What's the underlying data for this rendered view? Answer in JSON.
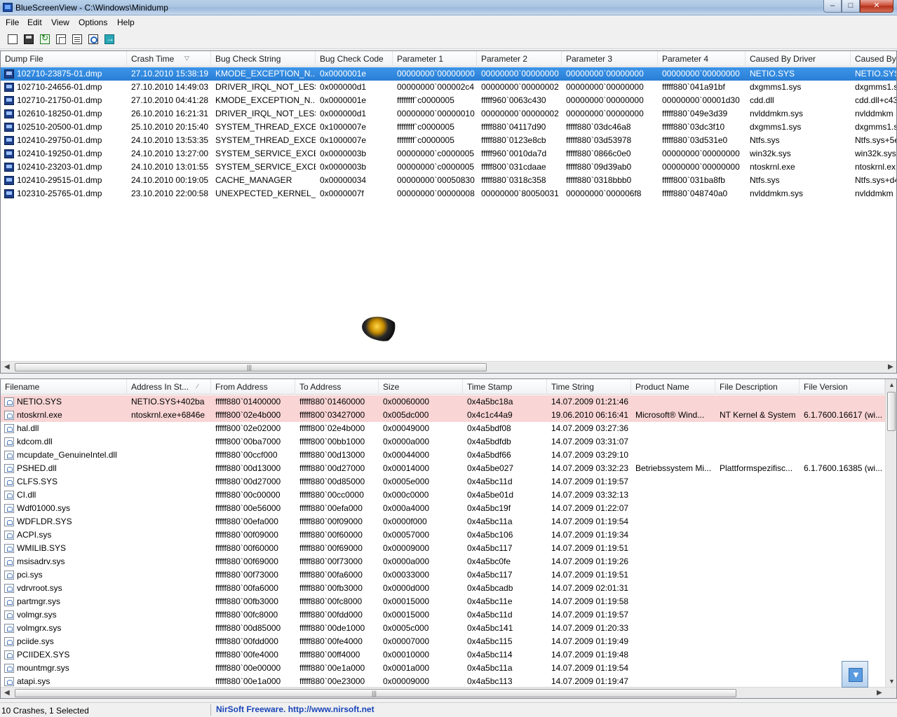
{
  "window": {
    "title": "BlueScreenView  -  C:\\Windows\\Minidump",
    "min": "–",
    "max": "□",
    "close": "✕"
  },
  "menu": [
    "File",
    "Edit",
    "View",
    "Options",
    "Help"
  ],
  "toolbar": [
    "select-columns-icon",
    "save-icon",
    "refresh-icon",
    "copy-icon",
    "properties-icon",
    "find-icon",
    "exit-icon"
  ],
  "upper": {
    "columns": [
      "Dump File",
      "Crash Time",
      "Bug Check String",
      "Bug Check Code",
      "Parameter 1",
      "Parameter 2",
      "Parameter 3",
      "Parameter 4",
      "Caused By Driver",
      "Caused By ..."
    ],
    "rows": [
      [
        "102710-23875-01.dmp",
        "27.10.2010 15:38:19",
        "KMODE_EXCEPTION_N...",
        "0x0000001e",
        "00000000`00000000",
        "00000000`00000000",
        "00000000`00000000",
        "00000000`00000000",
        "NETIO.SYS",
        "NETIO.SYS+"
      ],
      [
        "102710-24656-01.dmp",
        "27.10.2010 14:49:03",
        "DRIVER_IRQL_NOT_LESS...",
        "0x000000d1",
        "00000000`000002c4",
        "00000000`00000002",
        "00000000`00000000",
        "fffff880`041a91bf",
        "dxgmms1.sys",
        "dxgmms1.s"
      ],
      [
        "102710-21750-01.dmp",
        "27.10.2010 04:41:28",
        "KMODE_EXCEPTION_N...",
        "0x0000001e",
        "ffffffff`c0000005",
        "fffff960`0063c430",
        "00000000`00000000",
        "00000000`00001d30",
        "cdd.dll",
        "cdd.dll+c43"
      ],
      [
        "102610-18250-01.dmp",
        "26.10.2010 16:21:31",
        "DRIVER_IRQL_NOT_LESS...",
        "0x000000d1",
        "00000000`00000010",
        "00000000`00000002",
        "00000000`00000000",
        "fffff880`049e3d39",
        "nvlddmkm.sys",
        "nvlddmkm"
      ],
      [
        "102510-20500-01.dmp",
        "25.10.2010 20:15:40",
        "SYSTEM_THREAD_EXCE...",
        "0x1000007e",
        "ffffffff`c0000005",
        "fffff880`04117d90",
        "fffff880`03dc46a8",
        "fffff880`03dc3f10",
        "dxgmms1.sys",
        "dxgmms1.s"
      ],
      [
        "102410-29750-01.dmp",
        "24.10.2010 13:53:35",
        "SYSTEM_THREAD_EXCE...",
        "0x1000007e",
        "ffffffff`c0000005",
        "fffff880`0123e8cb",
        "fffff880`03d53978",
        "fffff880`03d531e0",
        "Ntfs.sys",
        "Ntfs.sys+5e"
      ],
      [
        "102410-19250-01.dmp",
        "24.10.2010 13:27:00",
        "SYSTEM_SERVICE_EXCE...",
        "0x0000003b",
        "00000000`c0000005",
        "fffff960`0010da7d",
        "fffff880`0866c0e0",
        "00000000`00000000",
        "win32k.sys",
        "win32k.sys+"
      ],
      [
        "102410-23203-01.dmp",
        "24.10.2010 13:01:55",
        "SYSTEM_SERVICE_EXCE...",
        "0x0000003b",
        "00000000`c0000005",
        "fffff800`031cdaae",
        "fffff880`09d39ab0",
        "00000000`00000000",
        "ntoskrnl.exe",
        "ntoskrnl.ex"
      ],
      [
        "102410-29515-01.dmp",
        "24.10.2010 00:19:05",
        "CACHE_MANAGER",
        "0x00000034",
        "00000000`00050830",
        "fffff880`0318c358",
        "fffff880`0318bbb0",
        "fffff800`031ba8fb",
        "Ntfs.sys",
        "Ntfs.sys+d4"
      ],
      [
        "102310-25765-01.dmp",
        "23.10.2010 22:00:58",
        "UNEXPECTED_KERNEL_...",
        "0x0000007f",
        "00000000`00000008",
        "00000000`80050031",
        "00000000`000006f8",
        "fffff880`048740a0",
        "nvlddmkm.sys",
        "nvlddmkm"
      ]
    ]
  },
  "lower": {
    "columns": [
      "Filename",
      "Address In St...",
      "From Address",
      "To Address",
      "Size",
      "Time Stamp",
      "Time String",
      "Product Name",
      "File Description",
      "File Version"
    ],
    "rows": [
      [
        "NETIO.SYS",
        "NETIO.SYS+402ba",
        "fffff880`01400000",
        "fffff880`01460000",
        "0x00060000",
        "0x4a5bc18a",
        "14.07.2009 01:21:46",
        "",
        "",
        ""
      ],
      [
        "ntoskrnl.exe",
        "ntoskrnl.exe+6846e",
        "fffff800`02e4b000",
        "fffff800`03427000",
        "0x005dc000",
        "0x4c1c44a9",
        "19.06.2010 06:16:41",
        "Microsoft® Wind...",
        "NT Kernel & System",
        "6.1.7600.16617 (wi..."
      ],
      [
        "hal.dll",
        "",
        "fffff800`02e02000",
        "fffff800`02e4b000",
        "0x00049000",
        "0x4a5bdf08",
        "14.07.2009 03:27:36",
        "",
        "",
        ""
      ],
      [
        "kdcom.dll",
        "",
        "fffff800`00ba7000",
        "fffff800`00bb1000",
        "0x0000a000",
        "0x4a5bdfdb",
        "14.07.2009 03:31:07",
        "",
        "",
        ""
      ],
      [
        "mcupdate_GenuineIntel.dll",
        "",
        "fffff880`00ccf000",
        "fffff880`00d13000",
        "0x00044000",
        "0x4a5bdf66",
        "14.07.2009 03:29:10",
        "",
        "",
        ""
      ],
      [
        "PSHED.dll",
        "",
        "fffff880`00d13000",
        "fffff880`00d27000",
        "0x00014000",
        "0x4a5be027",
        "14.07.2009 03:32:23",
        "Betriebssystem Mi...",
        "Plattformspezifisc...",
        "6.1.7600.16385 (wi..."
      ],
      [
        "CLFS.SYS",
        "",
        "fffff880`00d27000",
        "fffff880`00d85000",
        "0x0005e000",
        "0x4a5bc11d",
        "14.07.2009 01:19:57",
        "",
        "",
        ""
      ],
      [
        "CI.dll",
        "",
        "fffff880`00c00000",
        "fffff880`00cc0000",
        "0x000c0000",
        "0x4a5be01d",
        "14.07.2009 03:32:13",
        "",
        "",
        ""
      ],
      [
        "Wdf01000.sys",
        "",
        "fffff880`00e56000",
        "fffff880`00efa000",
        "0x000a4000",
        "0x4a5bc19f",
        "14.07.2009 01:22:07",
        "",
        "",
        ""
      ],
      [
        "WDFLDR.SYS",
        "",
        "fffff880`00efa000",
        "fffff880`00f09000",
        "0x0000f000",
        "0x4a5bc11a",
        "14.07.2009 01:19:54",
        "",
        "",
        ""
      ],
      [
        "ACPI.sys",
        "",
        "fffff880`00f09000",
        "fffff880`00f60000",
        "0x00057000",
        "0x4a5bc106",
        "14.07.2009 01:19:34",
        "",
        "",
        ""
      ],
      [
        "WMILIB.SYS",
        "",
        "fffff880`00f60000",
        "fffff880`00f69000",
        "0x00009000",
        "0x4a5bc117",
        "14.07.2009 01:19:51",
        "",
        "",
        ""
      ],
      [
        "msisadrv.sys",
        "",
        "fffff880`00f69000",
        "fffff880`00f73000",
        "0x0000a000",
        "0x4a5bc0fe",
        "14.07.2009 01:19:26",
        "",
        "",
        ""
      ],
      [
        "pci.sys",
        "",
        "fffff880`00f73000",
        "fffff880`00fa6000",
        "0x00033000",
        "0x4a5bc117",
        "14.07.2009 01:19:51",
        "",
        "",
        ""
      ],
      [
        "vdrvroot.sys",
        "",
        "fffff880`00fa6000",
        "fffff880`00fb3000",
        "0x0000d000",
        "0x4a5bcadb",
        "14.07.2009 02:01:31",
        "",
        "",
        ""
      ],
      [
        "partmgr.sys",
        "",
        "fffff880`00fb3000",
        "fffff880`00fc8000",
        "0x00015000",
        "0x4a5bc11e",
        "14.07.2009 01:19:58",
        "",
        "",
        ""
      ],
      [
        "volmgr.sys",
        "",
        "fffff880`00fc8000",
        "fffff880`00fdd000",
        "0x00015000",
        "0x4a5bc11d",
        "14.07.2009 01:19:57",
        "",
        "",
        ""
      ],
      [
        "volmgrx.sys",
        "",
        "fffff880`00d85000",
        "fffff880`00de1000",
        "0x0005c000",
        "0x4a5bc141",
        "14.07.2009 01:20:33",
        "",
        "",
        ""
      ],
      [
        "pciide.sys",
        "",
        "fffff880`00fdd000",
        "fffff880`00fe4000",
        "0x00007000",
        "0x4a5bc115",
        "14.07.2009 01:19:49",
        "",
        "",
        ""
      ],
      [
        "PCIIDEX.SYS",
        "",
        "fffff880`00fe4000",
        "fffff880`00ff4000",
        "0x00010000",
        "0x4a5bc114",
        "14.07.2009 01:19:48",
        "",
        "",
        ""
      ],
      [
        "mountmgr.sys",
        "",
        "fffff880`00e00000",
        "fffff880`00e1a000",
        "0x0001a000",
        "0x4a5bc11a",
        "14.07.2009 01:19:54",
        "",
        "",
        ""
      ],
      [
        "atapi.sys",
        "",
        "fffff880`00e1a000",
        "fffff880`00e23000",
        "0x00009000",
        "0x4a5bc113",
        "14.07.2009 01:19:47",
        "",
        "",
        ""
      ]
    ]
  },
  "status": {
    "count": "10 Crashes, 1 Selected",
    "link": "NirSoft Freeware.  http://www.nirsoft.net"
  },
  "colors": {
    "selection": "#3d95e8",
    "highlight_row": "#f9d5d5",
    "link": "#1a44b8"
  }
}
